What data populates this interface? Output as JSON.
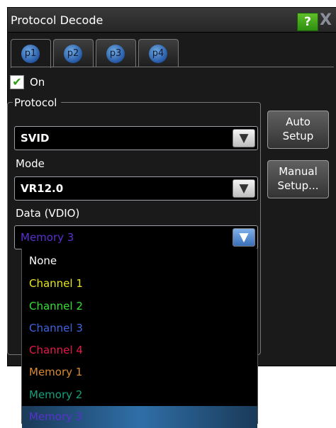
{
  "window": {
    "title": "Protocol Decode",
    "help_label": "?",
    "close_label": "X"
  },
  "tabs": [
    {
      "label": "p1",
      "active": true
    },
    {
      "label": "p2",
      "active": false
    },
    {
      "label": "p3",
      "active": false
    },
    {
      "label": "p4",
      "active": false
    }
  ],
  "on_checkbox": {
    "label": "On",
    "checked": true
  },
  "protocol_group": {
    "title": "Protocol"
  },
  "protocol": {
    "value": "SVID"
  },
  "mode": {
    "label": "Mode",
    "value": "VR12.0"
  },
  "data": {
    "label": "Data (VDIO)",
    "value": "Memory 3"
  },
  "buttons": {
    "auto_setup": {
      "line1": "Auto",
      "line2": "Setup"
    },
    "manual_setup": {
      "line1": "Manual",
      "line2": "Setup..."
    }
  },
  "dropdown_options": [
    {
      "label": "None",
      "color": "#ffffff"
    },
    {
      "label": "Channel 1",
      "color": "#e6e619"
    },
    {
      "label": "Channel 2",
      "color": "#33e033"
    },
    {
      "label": "Channel 3",
      "color": "#3f63e0"
    },
    {
      "label": "Channel 4",
      "color": "#e3184a"
    },
    {
      "label": "Memory 1",
      "color": "#d98a2f"
    },
    {
      "label": "Memory 2",
      "color": "#12a07a"
    },
    {
      "label": "Memory 3",
      "color": "#5a2fd0",
      "selected": true
    }
  ],
  "colors": {
    "data_value": "#5a2fd0",
    "accent_blue": "#2f6fa8",
    "help_green": "#3da01a"
  }
}
